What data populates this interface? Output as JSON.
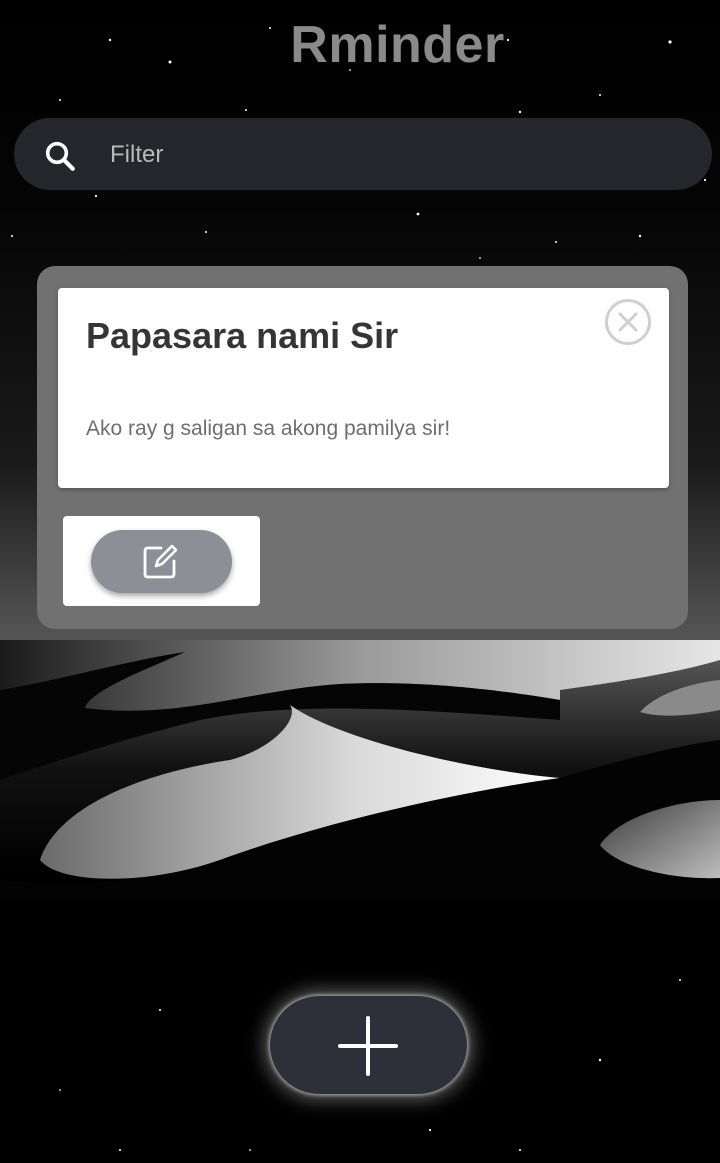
{
  "app": {
    "title": "Rminder"
  },
  "search": {
    "placeholder": "Filter",
    "value": "",
    "icon": "search-icon"
  },
  "notes": [
    {
      "title": "Papasara nami Sir",
      "body": "Ako ray g saligan sa akong pamilya sir!",
      "close_icon": "close-circle-icon",
      "edit_icon": "edit-icon"
    }
  ],
  "fab": {
    "icon": "plus-icon"
  },
  "colors": {
    "background": "#000000",
    "search_bar": "#25262b",
    "card": "#717171",
    "note": "#ffffff",
    "title_text": "#8a8a8a",
    "edit_button": "#8c8f96",
    "add_button": "#2e3039"
  }
}
